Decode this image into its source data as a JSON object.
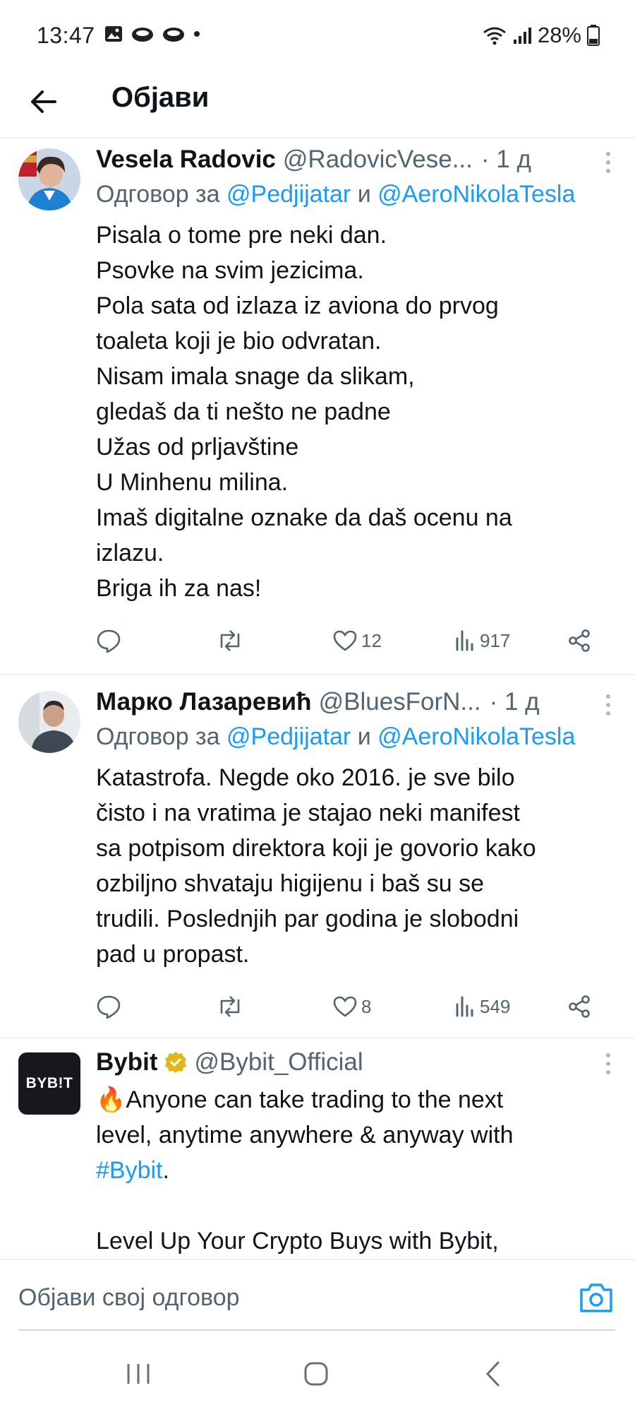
{
  "status_bar": {
    "time": "13:47",
    "battery": "28%",
    "left_icons": [
      "gallery-icon",
      "cloud-icon",
      "cloud-icon",
      "dot-icon"
    ],
    "right_icons": [
      "wifi-icon",
      "signal-icon",
      "battery-icon"
    ]
  },
  "header": {
    "title": "Објави",
    "back_icon": "arrow-left-icon"
  },
  "tweets": [
    {
      "name": "Vesela Radovic",
      "handle": "@RadovicVese...",
      "time": "· 1 д",
      "reply_prefix": "Одговор за",
      "reply_mention_1": "@Pedjijatar",
      "reply_and": "и",
      "reply_mention_2": "@AeroNikolaTesla",
      "lines": [
        "Pisala o tome pre neki dan.",
        "Psovke na svim jezicima.",
        "Pola sata od izlaza iz aviona do prvog",
        "toaleta koji je bio odvratan.",
        "Nisam imala snage da slikam,",
        "gledaš da ti nešto ne padne",
        "Užas od prljavštine",
        "U Minhenu milina.",
        "Imaš digitalne oznake da daš ocenu na",
        "izlazu.",
        "Briga ih za nas!"
      ],
      "likes": "12",
      "views": "917"
    },
    {
      "name": "Марко Лазаревић",
      "handle": "@BluesForN...",
      "time": "· 1 д",
      "reply_prefix": "Одговор за",
      "reply_mention_1": "@Pedjijatar",
      "reply_and": "и",
      "reply_mention_2": "@AeroNikolaTesla",
      "lines": [
        "Katastrofa. Negde oko 2016. je sve bilo",
        "čisto i na vratima je stajao neki manifest",
        "sa potpisom direktora koji je govorio kako",
        "ozbiljno shvataju higijenu i baš su se",
        "trudili. Poslednjih par godina je slobodni",
        "pad u propast."
      ],
      "likes": "8",
      "views": "549"
    },
    {
      "name": "Bybit",
      "handle": "@Bybit_Official",
      "avatar_text": "BYB!T",
      "line_1": "🔥Anyone can take trading to the next",
      "line_2": "level, anytime anywhere & anyway with",
      "hashtag": "#Bybit",
      "hashtag_suffix": ".",
      "line_4": "Level Up Your Crypto Buys with Bybit,"
    }
  ],
  "composer": {
    "placeholder": "Објави свој одговор",
    "camera_icon": "camera-icon"
  },
  "colors": {
    "accent": "#1d9bf0",
    "secondary_text": "#536471",
    "primary_text": "#0f1419",
    "verified_badge": "#e2b719"
  }
}
